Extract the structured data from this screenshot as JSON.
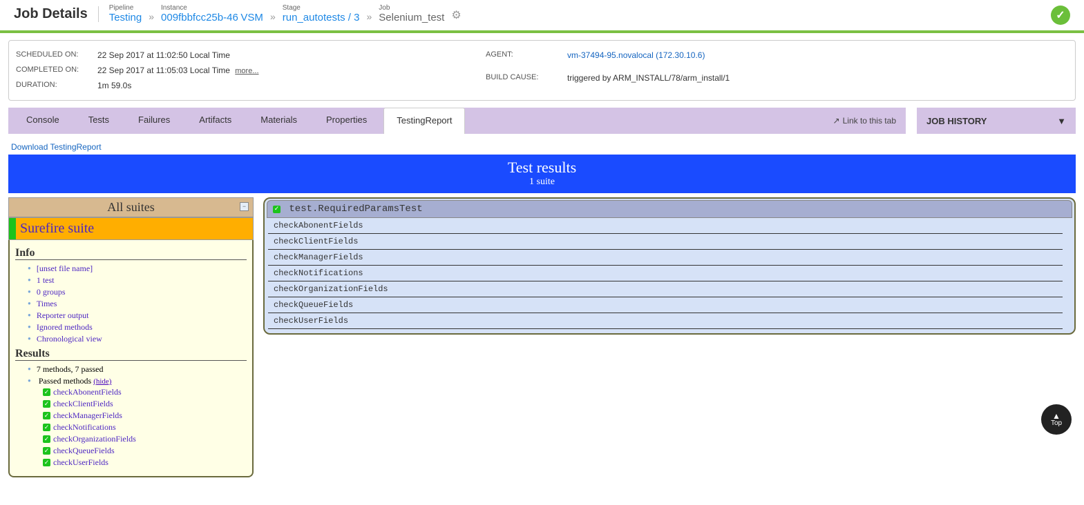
{
  "header": {
    "title": "Job Details",
    "crumbs": {
      "pipeline_label": "Pipeline",
      "pipeline_value": "Testing",
      "instance_label": "Instance",
      "instance_value": "009fbbfcc25b-46",
      "instance_vsm": "VSM",
      "stage_label": "Stage",
      "stage_value": "run_autotests / 3",
      "job_label": "Job",
      "job_value": "Selenium_test"
    }
  },
  "summary": {
    "scheduled_label": "SCHEDULED ON:",
    "scheduled_value": "22 Sep 2017 at 11:02:50 Local Time",
    "completed_label": "COMPLETED ON:",
    "completed_value": "22 Sep 2017 at 11:05:03 Local Time",
    "more": "more...",
    "duration_label": "DURATION:",
    "duration_value": "1m 59.0s",
    "agent_label": "AGENT:",
    "agent_value": "vm-37494-95.novalocal (172.30.10.6)",
    "build_cause_label": "BUILD CAUSE:",
    "build_cause_value": "triggered by ARM_INSTALL/78/arm_install/1"
  },
  "tabs": {
    "items": [
      "Console",
      "Tests",
      "Failures",
      "Artifacts",
      "Materials",
      "Properties",
      "TestingReport"
    ],
    "active_index": 6,
    "link_to_tab": "Link to this tab",
    "job_history": "JOB HISTORY"
  },
  "report": {
    "download": "Download TestingReport",
    "banner_title": "Test results",
    "banner_sub": "1 suite",
    "all_suites": "All suites",
    "suite_name": "Surefire suite",
    "info_heading": "Info",
    "info_items": [
      "[unset file name]",
      "1 test",
      "0 groups",
      "Times",
      "Reporter output",
      "Ignored methods",
      "Chronological view"
    ],
    "results_heading": "Results",
    "results_summary": "7 methods, 7 passed",
    "passed_label": "Passed methods",
    "hide": "(hide)",
    "passed_methods": [
      "checkAbonentFields",
      "checkClientFields",
      "checkManagerFields",
      "checkNotifications",
      "checkOrganizationFields",
      "checkQueueFields",
      "checkUserFields"
    ],
    "class_name": "test.RequiredParamsTest",
    "methods": [
      "checkAbonentFields",
      "checkClientFields",
      "checkManagerFields",
      "checkNotifications",
      "checkOrganizationFields",
      "checkQueueFields",
      "checkUserFields"
    ]
  },
  "back_top": {
    "label": "Top"
  }
}
